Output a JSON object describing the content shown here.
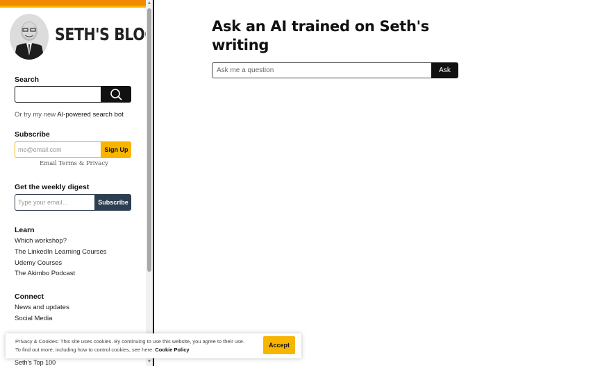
{
  "colors": {
    "accent_orange": "#f08a00",
    "accent_yellow": "#f7b500",
    "digest_navy": "#2c3e50",
    "dark": "#111111"
  },
  "sidebar": {
    "logo_text": "SETH'S BLOG",
    "search": {
      "heading": "Search",
      "icon": "search-icon"
    },
    "ai_line": {
      "prefix": "Or try my new ",
      "link": "AI-powered search bot"
    },
    "subscribe": {
      "heading": "Subscribe",
      "placeholder": "me@email.com",
      "button": "Sign Up",
      "terms": "Email Terms & Privacy"
    },
    "digest": {
      "heading": "Get the weekly digest",
      "placeholder": "Type your email…",
      "button": "Subscribe"
    },
    "learn": {
      "heading": "Learn",
      "items": [
        "Which workshop?",
        "The LinkedIn Learning Courses",
        "Udemy Courses",
        "The Akimbo Podcast"
      ]
    },
    "connect": {
      "heading": "Connect",
      "items": [
        "News and updates",
        "Social Media"
      ]
    },
    "partial_item": "Seth's Top 100"
  },
  "main": {
    "title": "Ask an AI trained on Seth's writing",
    "input_placeholder": "Ask me a question",
    "button": "Ask"
  },
  "cookie": {
    "line1": "Privacy & Cookies: This site uses cookies. By continuing to use this website, you agree to their use.",
    "line2_prefix": "To find out more, including how to control cookies, see here: ",
    "policy_link": "Cookie Policy",
    "accept": "Accept"
  }
}
